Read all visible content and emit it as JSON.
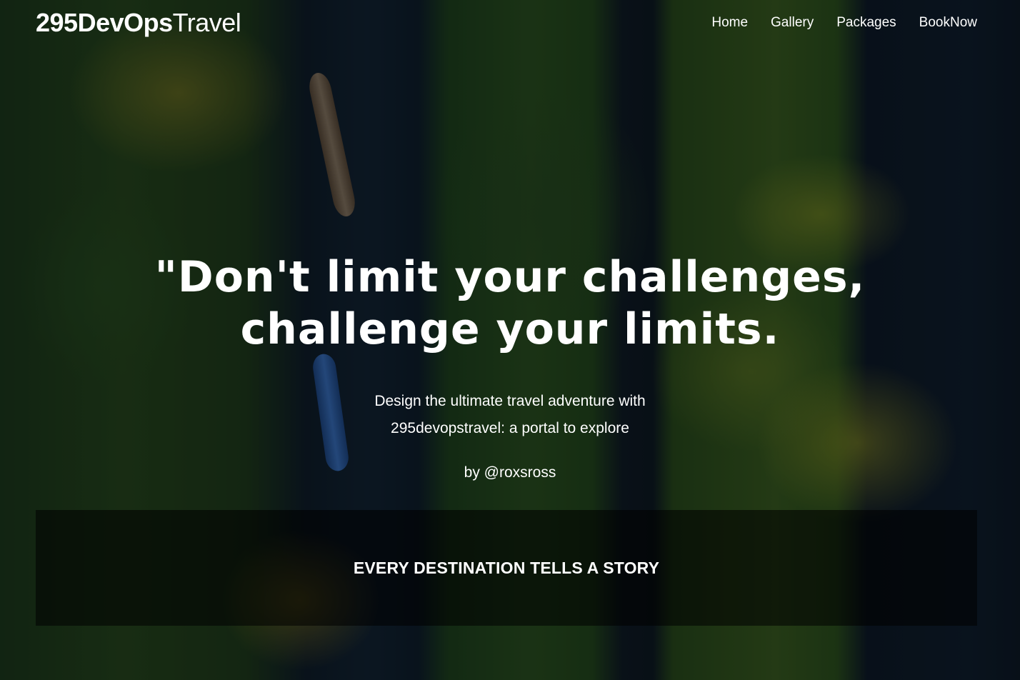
{
  "brand": {
    "logo_bold": "295DevOps",
    "logo_light": "Travel"
  },
  "nav": {
    "items": [
      {
        "label": "Home"
      },
      {
        "label": "Gallery"
      },
      {
        "label": "Packages"
      },
      {
        "label": "BookNow"
      }
    ]
  },
  "hero": {
    "headline": "\"Don't limit your challenges, challenge your limits.",
    "subtitle_line1": "Design the ultimate travel adventure with",
    "subtitle_line2": "295devopstravel: a portal to explore",
    "byline": "by @roxsross"
  },
  "banner": {
    "title": "EVERY DESTINATION TELLS A STORY"
  },
  "colors": {
    "text": "#ffffff",
    "banner_bg": "rgba(0,0,0,0.55)"
  }
}
